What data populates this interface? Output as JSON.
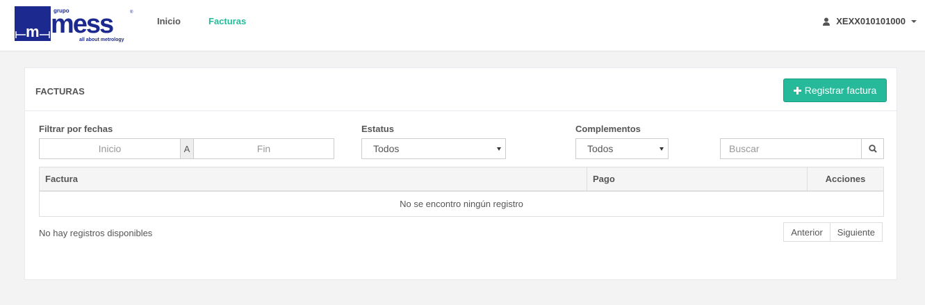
{
  "header": {
    "logo": {
      "top_text": "grupo",
      "brand": "mess",
      "tagline": "all about metrology",
      "mark_letter": "m",
      "trademark": "®"
    },
    "nav": [
      {
        "label": "Inicio",
        "active": false
      },
      {
        "label": "Facturas",
        "active": true
      }
    ],
    "user": {
      "name": "XEXX010101000",
      "icon": "user-icon"
    }
  },
  "panel": {
    "title": "FACTURAS",
    "register_button": {
      "icon": "plus-icon",
      "label": "Registrar factura"
    },
    "filters": {
      "date_label": "Filtrar por fechas",
      "date_start_placeholder": "Inicio",
      "date_separator": "A",
      "date_end_placeholder": "Fin",
      "status_label": "Estatus",
      "status_value": "Todos",
      "complements_label": "Complementos",
      "complements_value": "Todos",
      "search_placeholder": "Buscar",
      "search_icon": "search-icon"
    },
    "table": {
      "columns": [
        "Factura",
        "Pago",
        "Acciones"
      ],
      "empty_message": "No se encontro ningún registro"
    },
    "footer": {
      "info": "No hay registros disponibles",
      "prev": "Anterior",
      "next": "Siguiente"
    }
  },
  "colors": {
    "accent": "#26b99a",
    "logo_blue": "#1c2a8f"
  }
}
